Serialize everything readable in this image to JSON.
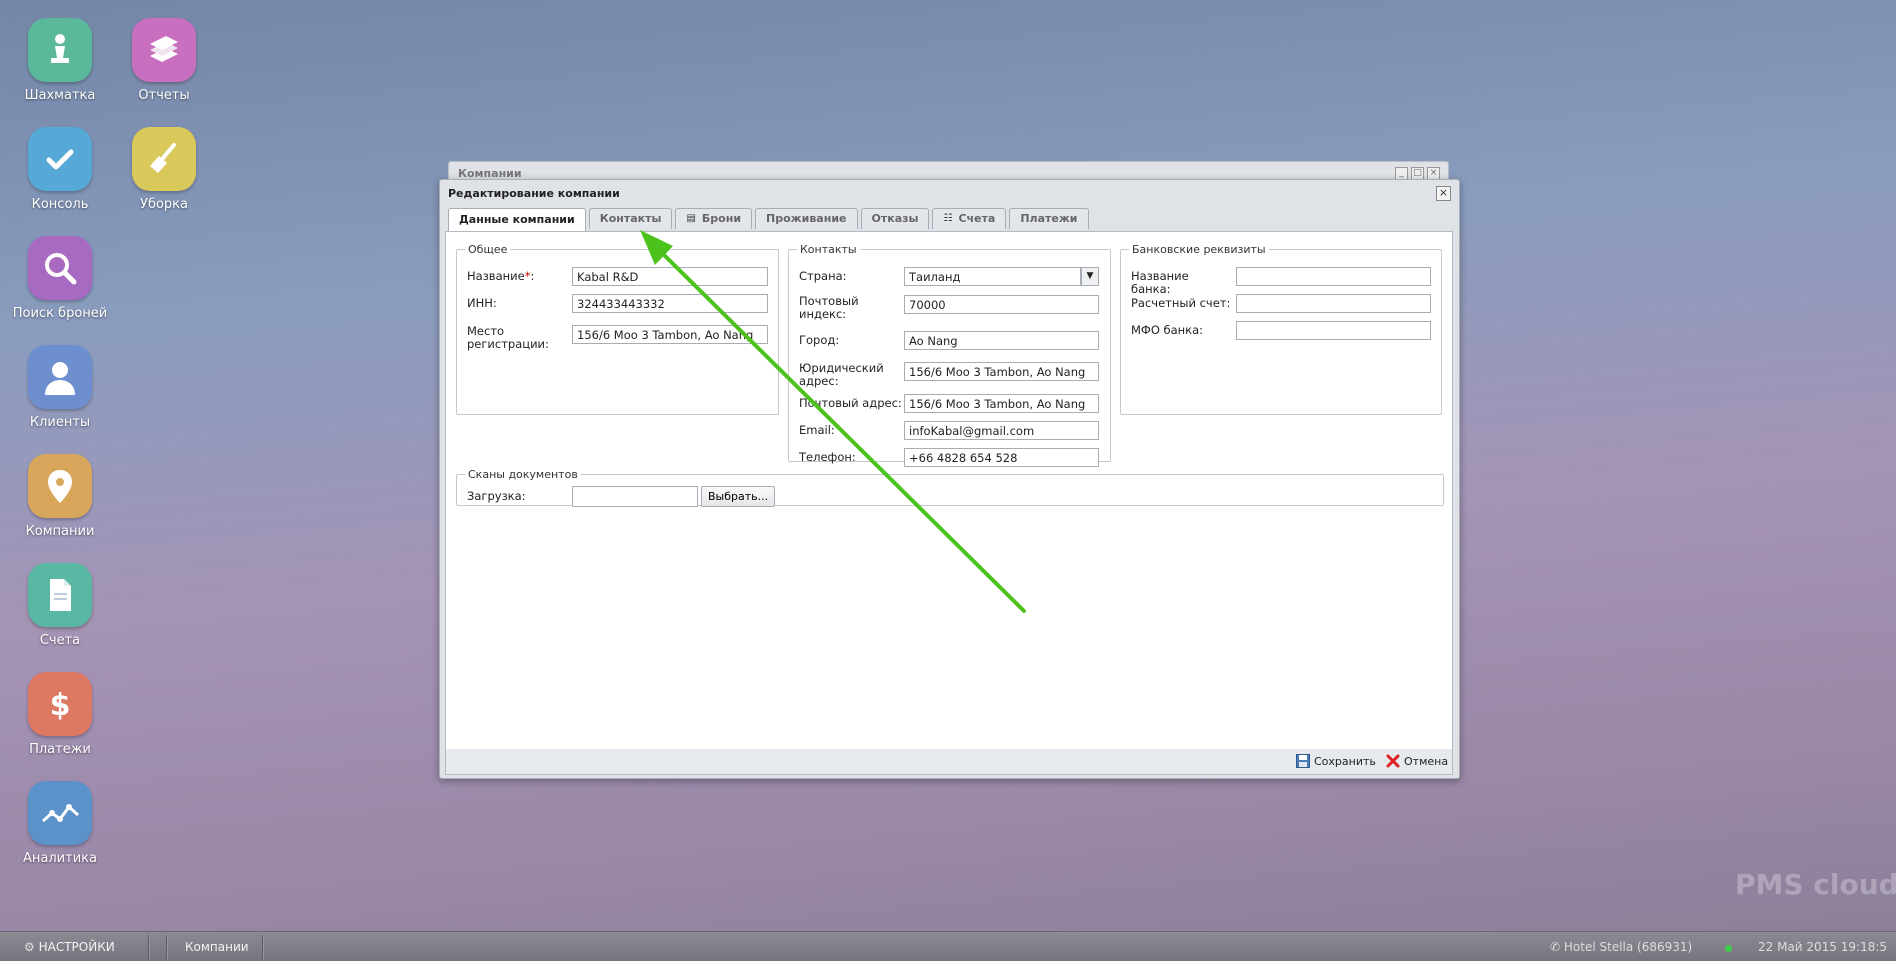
{
  "desktop": {
    "icons": [
      {
        "label": "Шахматка",
        "color": "#5bb89a",
        "icon": "chess-pawn-icon"
      },
      {
        "label": "Отчеты",
        "color": "#c86fc0",
        "icon": "books-icon"
      },
      {
        "label": "Консоль",
        "color": "#56a9d6",
        "icon": "checkmark-icon"
      },
      {
        "label": "Уборка",
        "color": "#d8c95a",
        "icon": "broom-icon"
      },
      {
        "label": "Поиск броней",
        "color": "#a86ac0",
        "icon": "magnifier-icon"
      },
      {
        "label": "Клиенты",
        "color": "#6d8fcf",
        "icon": "person-icon"
      },
      {
        "label": "Компании",
        "color": "#d8a75c",
        "icon": "map-pin-icon"
      },
      {
        "label": "Счета",
        "color": "#5ab7a4",
        "icon": "document-icon"
      },
      {
        "label": "Платежи",
        "color": "#dd7862",
        "icon": "dollar-icon"
      },
      {
        "label": "Аналитика",
        "color": "#5a92c9",
        "icon": "line-chart-icon"
      }
    ]
  },
  "background_window": {
    "title": "Компании"
  },
  "dialog": {
    "title": "Редактирование компании",
    "tabs": [
      {
        "label": "Данные компании",
        "active": true
      },
      {
        "label": "Контакты"
      },
      {
        "label": "Брони",
        "icon": "briefcase-icon"
      },
      {
        "label": "Проживание"
      },
      {
        "label": "Отказы"
      },
      {
        "label": "Счета",
        "icon": "document-icon"
      },
      {
        "label": "Платежи"
      }
    ],
    "general": {
      "legend": "Общее",
      "name_label": "Название",
      "name_req": "*",
      "name_colon": ":",
      "name_value": "Kabal R&D",
      "inn_label": "ИНН:",
      "inn_value": "324433443332",
      "reg_label": "Место регистрации:",
      "reg_value": "156/6 Moo 3 Tambon, Ao Nang"
    },
    "contacts": {
      "legend": "Контакты",
      "country_label": "Страна:",
      "country_value": "Таиланд",
      "postcode_label": "Почтовый индекс:",
      "postcode_value": "70000",
      "city_label": "Город:",
      "city_value": "Ao Nang",
      "legal_label": "Юридический адрес:",
      "legal_value": "156/6 Moo 3 Tambon, Ao Nang",
      "postal_label": "Почтовый адрес:",
      "postal_value": "156/6 Moo 3 Tambon, Ao Nang",
      "email_label": "Email:",
      "email_value": "infoKabal@gmail.com",
      "phone_label": "Телефон:",
      "phone_value": "+66 4828 654 528"
    },
    "bank": {
      "legend": "Банковские реквизиты",
      "bank_name_label": "Название банка:",
      "bank_name_value": "",
      "account_label": "Расчетный счет:",
      "account_value": "",
      "mfo_label": "МФО банка:",
      "mfo_value": ""
    },
    "scans": {
      "legend": "Сканы документов",
      "upload_label": "Загрузка:",
      "upload_value": "",
      "choose_label": "Выбрать..."
    },
    "footer": {
      "save_label": "Сохранить",
      "cancel_label": "Отмена"
    }
  },
  "annotation": {
    "arrow_color": "#4cc21c"
  },
  "taskbar": {
    "settings_label": "НАСТРОЙКИ",
    "window_label": "Компании",
    "hotel": "Hotel Stella (686931)",
    "datetime": "22 Май 2015 19:18:5"
  },
  "watermark": "PMS cloud"
}
